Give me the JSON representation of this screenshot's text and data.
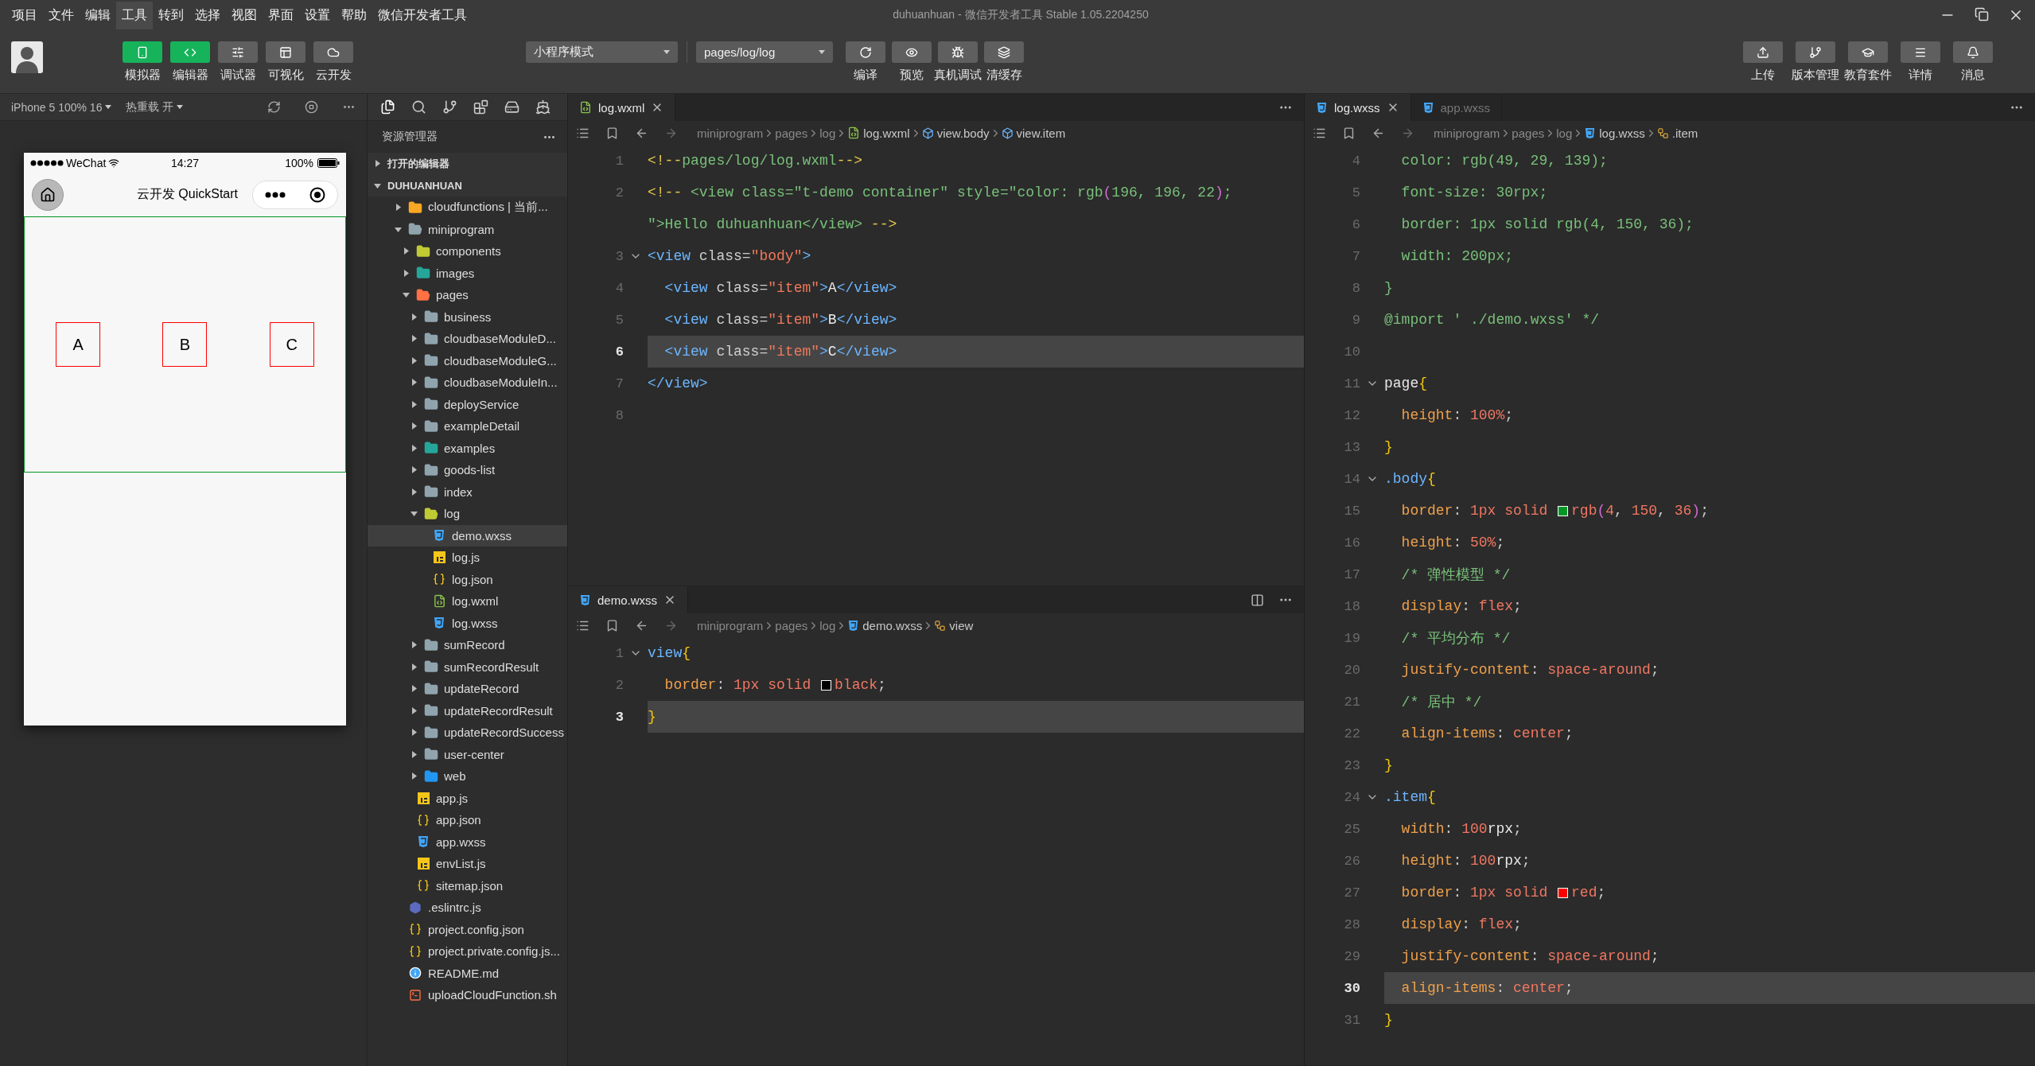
{
  "menu_bar": {
    "items": [
      {
        "label": "项目",
        "highlighted": false
      },
      {
        "label": "文件",
        "highlighted": false
      },
      {
        "label": "编辑",
        "highlighted": false
      },
      {
        "label": "工具",
        "highlighted": true
      },
      {
        "label": "转到",
        "highlighted": false
      },
      {
        "label": "选择",
        "highlighted": false
      },
      {
        "label": "视图",
        "highlighted": false
      },
      {
        "label": "界面",
        "highlighted": false
      },
      {
        "label": "设置",
        "highlighted": false
      },
      {
        "label": "帮助",
        "highlighted": false
      },
      {
        "label": "微信开发者工具",
        "highlighted": false
      }
    ],
    "title": "duhuanhuan - 微信开发者工具 Stable 1.05.2204250"
  },
  "toolbar": {
    "view_buttons": [
      {
        "label": "模拟器",
        "on": true
      },
      {
        "label": "编辑器",
        "on": true
      },
      {
        "label": "调试器",
        "on": false
      },
      {
        "label": "可视化",
        "on": false
      },
      {
        "label": "云开发",
        "on": false
      }
    ],
    "mode_select": "小程序模式",
    "page_select": "pages/log/log",
    "actions": [
      "编译",
      "预览",
      "真机调试",
      "清缓存"
    ],
    "right_buttons": [
      "上传",
      "版本管理",
      "教育套件",
      "详情",
      "消息"
    ]
  },
  "simulator": {
    "device": "iPhone 5 100% 16",
    "hot_reload": "热重载 开",
    "status_bar": {
      "carrier": "WeChat",
      "time": "14:27",
      "battery": "100%"
    },
    "nav_title": "云开发 QuickStart",
    "items": [
      "A",
      "B",
      "C"
    ]
  },
  "explorer": {
    "title": "资源管理器",
    "sections": [
      {
        "label": "打开的编辑器",
        "expanded": false
      },
      {
        "label": "DUHUANHUAN",
        "expanded": true,
        "children": [
          {
            "label": "cloudfunctions | 当前...",
            "kind": "folder",
            "color": "#f9a825",
            "expanded": false,
            "selected": false
          },
          {
            "label": "miniprogram",
            "kind": "folder",
            "color": "#90a4ae",
            "expanded": true,
            "selected": false,
            "children": [
              {
                "label": "components",
                "kind": "folder",
                "color": "#c0ca33",
                "expanded": false,
                "selected": false
              },
              {
                "label": "images",
                "kind": "folder",
                "color": "#26a69a",
                "expanded": false,
                "selected": false
              },
              {
                "label": "pages",
                "kind": "folder",
                "color": "#ff7043",
                "expanded": true,
                "selected": false,
                "children": [
                  {
                    "label": "business",
                    "kind": "folder",
                    "color": "#90a4ae",
                    "expanded": false,
                    "selected": false
                  },
                  {
                    "label": "cloudbaseModuleD...",
                    "kind": "folder",
                    "color": "#90a4ae",
                    "expanded": false,
                    "selected": false
                  },
                  {
                    "label": "cloudbaseModuleG...",
                    "kind": "folder",
                    "color": "#90a4ae",
                    "expanded": false,
                    "selected": false
                  },
                  {
                    "label": "cloudbaseModuleIn...",
                    "kind": "folder",
                    "color": "#90a4ae",
                    "expanded": false,
                    "selected": false
                  },
                  {
                    "label": "deployService",
                    "kind": "folder",
                    "color": "#90a4ae",
                    "expanded": false,
                    "selected": false
                  },
                  {
                    "label": "exampleDetail",
                    "kind": "folder",
                    "color": "#90a4ae",
                    "expanded": false,
                    "selected": false
                  },
                  {
                    "label": "examples",
                    "kind": "folder",
                    "color": "#26a69a",
                    "expanded": false,
                    "selected": false
                  },
                  {
                    "label": "goods-list",
                    "kind": "folder",
                    "color": "#90a4ae",
                    "expanded": false,
                    "selected": false
                  },
                  {
                    "label": "index",
                    "kind": "folder",
                    "color": "#90a4ae",
                    "expanded": false,
                    "selected": false
                  },
                  {
                    "label": "log",
                    "kind": "folder",
                    "color": "#c0ca33",
                    "expanded": true,
                    "selected": false,
                    "children": [
                      {
                        "label": "demo.wxss",
                        "kind": "wxss",
                        "selected": true
                      },
                      {
                        "label": "log.js",
                        "kind": "js",
                        "selected": false
                      },
                      {
                        "label": "log.json",
                        "kind": "json",
                        "selected": false
                      },
                      {
                        "label": "log.wxml",
                        "kind": "wxml",
                        "selected": false
                      },
                      {
                        "label": "log.wxss",
                        "kind": "wxss",
                        "selected": false
                      }
                    ]
                  },
                  {
                    "label": "sumRecord",
                    "kind": "folder",
                    "color": "#90a4ae",
                    "expanded": false,
                    "selected": false
                  },
                  {
                    "label": "sumRecordResult",
                    "kind": "folder",
                    "color": "#90a4ae",
                    "expanded": false,
                    "selected": false
                  },
                  {
                    "label": "updateRecord",
                    "kind": "folder",
                    "color": "#90a4ae",
                    "expanded": false,
                    "selected": false
                  },
                  {
                    "label": "updateRecordResult",
                    "kind": "folder",
                    "color": "#90a4ae",
                    "expanded": false,
                    "selected": false
                  },
                  {
                    "label": "updateRecordSuccess",
                    "kind": "folder",
                    "color": "#90a4ae",
                    "expanded": false,
                    "selected": false
                  },
                  {
                    "label": "user-center",
                    "kind": "folder",
                    "color": "#90a4ae",
                    "expanded": false,
                    "selected": false
                  },
                  {
                    "label": "web",
                    "kind": "folder",
                    "color": "#2196f3",
                    "expanded": false,
                    "selected": false
                  }
                ]
              },
              {
                "label": "app.js",
                "kind": "js",
                "selected": false
              },
              {
                "label": "app.json",
                "kind": "json",
                "selected": false
              },
              {
                "label": "app.wxss",
                "kind": "wxss",
                "selected": false
              },
              {
                "label": "envList.js",
                "kind": "js",
                "selected": false
              },
              {
                "label": "sitemap.json",
                "kind": "json",
                "selected": false
              }
            ]
          },
          {
            "label": ".eslintrc.js",
            "kind": "eslint",
            "selected": false
          },
          {
            "label": "project.config.json",
            "kind": "json",
            "selected": false
          },
          {
            "label": "project.private.config.js...",
            "kind": "json",
            "selected": false
          },
          {
            "label": "README.md",
            "kind": "readme",
            "selected": false
          },
          {
            "label": "uploadCloudFunction.sh",
            "kind": "shell",
            "selected": false
          }
        ]
      }
    ]
  },
  "editor_top": {
    "tabs": [
      {
        "label": "log.wxml",
        "kind": "wxml",
        "selected": true,
        "close": true
      }
    ],
    "breadcrumb": [
      {
        "label": "miniprogram",
        "kind": "folder"
      },
      {
        "label": "pages",
        "kind": "folder"
      },
      {
        "label": "log",
        "kind": "folder"
      },
      {
        "label": "log.wxml",
        "kind": "wxml"
      },
      {
        "label": "view.body",
        "kind": "element"
      },
      {
        "label": "view.item",
        "kind": "element"
      }
    ],
    "lines": [
      {
        "number": "1",
        "foldable": false,
        "current": false,
        "indented": false,
        "tokens": [
          {
            "kind": "cdelim",
            "text": "<!--"
          },
          {
            "kind": "comment",
            "text": "pages/log/log.wxml"
          },
          {
            "kind": "cdelim",
            "text": "-->"
          }
        ]
      },
      {
        "number": "2",
        "foldable": false,
        "current": false,
        "indented": false,
        "tokens": [
          {
            "kind": "cdelim",
            "text": "<!--"
          },
          {
            "kind": "comment",
            "text": " <view class=\"t-demo container\" style=\"color: rgb"
          },
          {
            "kind": "paren",
            "text": "("
          },
          {
            "kind": "comment",
            "text": "196, 196, 22"
          },
          {
            "kind": "paren",
            "text": ")"
          },
          {
            "kind": "comment",
            "text": ";"
          }
        ]
      },
      {
        "foldable": false,
        "current": false,
        "indented": false,
        "tokens": [
          {
            "kind": "comment",
            "text": "\">Hello duhuanhuan</view> "
          },
          {
            "kind": "cdelim",
            "text": "-->"
          }
        ]
      },
      {
        "number": "3",
        "foldable": true,
        "current": false,
        "indented": false,
        "tokens": [
          {
            "kind": "tag",
            "text": "<view"
          },
          {
            "kind": "attr",
            "text": " class"
          },
          {
            "kind": "punct",
            "text": "="
          },
          {
            "kind": "string",
            "text": "\"body\""
          },
          {
            "kind": "tag",
            "text": ">"
          }
        ]
      },
      {
        "number": "4",
        "foldable": false,
        "current": false,
        "indented": true,
        "tokens": [
          {
            "kind": "tag",
            "text": "<view"
          },
          {
            "kind": "attr",
            "text": " class"
          },
          {
            "kind": "punct",
            "text": "="
          },
          {
            "kind": "string",
            "text": "\"item\""
          },
          {
            "kind": "tag",
            "text": ">"
          },
          {
            "kind": "text",
            "text": "A"
          },
          {
            "kind": "tag",
            "text": "</view>"
          }
        ]
      },
      {
        "number": "5",
        "foldable": false,
        "current": false,
        "indented": true,
        "tokens": [
          {
            "kind": "tag",
            "text": "<view"
          },
          {
            "kind": "attr",
            "text": " class"
          },
          {
            "kind": "punct",
            "text": "="
          },
          {
            "kind": "string",
            "text": "\"item\""
          },
          {
            "kind": "tag",
            "text": ">"
          },
          {
            "kind": "text",
            "text": "B"
          },
          {
            "kind": "tag",
            "text": "</view>"
          }
        ]
      },
      {
        "number": "6",
        "foldable": false,
        "current": true,
        "indented": true,
        "tokens": [
          {
            "kind": "tag",
            "text": "<view"
          },
          {
            "kind": "attr",
            "text": " class"
          },
          {
            "kind": "punct",
            "text": "="
          },
          {
            "kind": "string",
            "text": "\"item\""
          },
          {
            "kind": "tag",
            "text": ">"
          },
          {
            "kind": "text",
            "text": "C"
          },
          {
            "kind": "tag",
            "text": "</view>"
          }
        ]
      },
      {
        "number": "7",
        "foldable": false,
        "current": false,
        "indented": false,
        "tokens": [
          {
            "kind": "tag",
            "text": "</view>"
          }
        ]
      },
      {
        "number": "8",
        "foldable": false,
        "current": false
      }
    ]
  },
  "editor_bottom": {
    "tabs": [
      {
        "label": "demo.wxss",
        "kind": "wxss",
        "selected": true,
        "close": true
      }
    ],
    "breadcrumb": [
      {
        "label": "miniprogram",
        "kind": "folder"
      },
      {
        "label": "pages",
        "kind": "folder"
      },
      {
        "label": "log",
        "kind": "folder"
      },
      {
        "label": "demo.wxss",
        "kind": "wxss"
      },
      {
        "label": "view",
        "kind": "rule"
      }
    ],
    "lines": [
      {
        "number": "1",
        "foldable": true,
        "current": false,
        "indented": false,
        "tokens": [
          {
            "kind": "selector",
            "text": "view"
          },
          {
            "kind": "brace",
            "text": "{"
          }
        ]
      },
      {
        "number": "2",
        "foldable": false,
        "current": false,
        "indented": true,
        "tokens": [
          {
            "kind": "prop",
            "text": "border"
          },
          {
            "kind": "punct",
            "text": ": "
          },
          {
            "kind": "value",
            "text": "1px solid "
          },
          {
            "kind": "swatch",
            "color": "#000000"
          },
          {
            "kind": "value",
            "text": "black"
          },
          {
            "kind": "punct",
            "text": ";"
          }
        ]
      },
      {
        "number": "3",
        "foldable": false,
        "current": true,
        "indented": false,
        "tokens": [
          {
            "kind": "brace",
            "text": "}"
          }
        ]
      }
    ]
  },
  "editor_right": {
    "tabs": [
      {
        "label": "log.wxss",
        "kind": "wxss",
        "selected": true,
        "close": true
      },
      {
        "label": "app.wxss",
        "kind": "wxss",
        "selected": false,
        "close": false
      }
    ],
    "breadcrumb": [
      {
        "label": "miniprogram",
        "kind": "folder"
      },
      {
        "label": "pages",
        "kind": "folder"
      },
      {
        "label": "log",
        "kind": "folder"
      },
      {
        "label": "log.wxss",
        "kind": "wxss"
      },
      {
        "label": ".item",
        "kind": "rule"
      }
    ],
    "lines": [
      {
        "number": "4",
        "foldable": false,
        "current": false,
        "indented": true,
        "tokens": [
          {
            "kind": "comment",
            "text": "color: rgb(49, 29, 139);"
          }
        ]
      },
      {
        "number": "5",
        "foldable": false,
        "current": false,
        "indented": true,
        "tokens": [
          {
            "kind": "comment",
            "text": "font-size: 30rpx;"
          }
        ]
      },
      {
        "number": "6",
        "foldable": false,
        "current": false,
        "indented": true,
        "tokens": [
          {
            "kind": "comment",
            "text": "border: 1px solid rgb(4, 150, 36);"
          }
        ]
      },
      {
        "number": "7",
        "foldable": false,
        "current": false,
        "indented": true,
        "tokens": [
          {
            "kind": "comment",
            "text": "width: 200px;"
          }
        ]
      },
      {
        "number": "8",
        "foldable": false,
        "current": false,
        "indented": false,
        "tokens": [
          {
            "kind": "comment",
            "text": "}"
          }
        ]
      },
      {
        "number": "9",
        "foldable": false,
        "current": false,
        "indented": false,
        "tokens": [
          {
            "kind": "comment",
            "text": "@import ' ./demo.wxss' */"
          }
        ]
      },
      {
        "number": "10",
        "foldable": false,
        "current": false
      },
      {
        "number": "11",
        "foldable": true,
        "current": false,
        "indented": false,
        "tokens": [
          {
            "kind": "element",
            "text": "page"
          },
          {
            "kind": "brace",
            "text": "{"
          }
        ]
      },
      {
        "number": "12",
        "foldable": false,
        "current": false,
        "indented": true,
        "tokens": [
          {
            "kind": "prop",
            "text": "height"
          },
          {
            "kind": "punct",
            "text": ": "
          },
          {
            "kind": "value",
            "text": "100%"
          },
          {
            "kind": "punct",
            "text": ";"
          }
        ]
      },
      {
        "number": "13",
        "foldable": false,
        "current": false,
        "indented": false,
        "tokens": [
          {
            "kind": "brace",
            "text": "}"
          }
        ]
      },
      {
        "number": "14",
        "foldable": true,
        "current": false,
        "indented": false,
        "tokens": [
          {
            "kind": "selector",
            "text": ".body"
          },
          {
            "kind": "brace",
            "text": "{"
          }
        ]
      },
      {
        "number": "15",
        "foldable": false,
        "current": false,
        "indented": true,
        "tokens": [
          {
            "kind": "prop",
            "text": "border"
          },
          {
            "kind": "punct",
            "text": ": "
          },
          {
            "kind": "value",
            "text": "1px solid "
          },
          {
            "kind": "swatch",
            "color": "#049624"
          },
          {
            "kind": "value",
            "text": "rgb"
          },
          {
            "kind": "paren",
            "text": "("
          },
          {
            "kind": "value",
            "text": "4"
          },
          {
            "kind": "punct",
            "text": ", "
          },
          {
            "kind": "value",
            "text": "150"
          },
          {
            "kind": "punct",
            "text": ", "
          },
          {
            "kind": "value",
            "text": "36"
          },
          {
            "kind": "paren",
            "text": ")"
          },
          {
            "kind": "punct",
            "text": ";"
          }
        ]
      },
      {
        "number": "16",
        "foldable": false,
        "current": false,
        "indented": true,
        "tokens": [
          {
            "kind": "prop",
            "text": "height"
          },
          {
            "kind": "punct",
            "text": ": "
          },
          {
            "kind": "value",
            "text": "50%"
          },
          {
            "kind": "punct",
            "text": ";"
          }
        ]
      },
      {
        "number": "17",
        "foldable": false,
        "current": false,
        "indented": true,
        "tokens": [
          {
            "kind": "comment",
            "text": "/* 弹性模型 */"
          }
        ]
      },
      {
        "number": "18",
        "foldable": false,
        "current": false,
        "indented": true,
        "tokens": [
          {
            "kind": "prop",
            "text": "display"
          },
          {
            "kind": "punct",
            "text": ": "
          },
          {
            "kind": "value",
            "text": "flex"
          },
          {
            "kind": "punct",
            "text": ";"
          }
        ]
      },
      {
        "number": "19",
        "foldable": false,
        "current": false,
        "indented": true,
        "tokens": [
          {
            "kind": "comment",
            "text": "/* 平均分布 */"
          }
        ]
      },
      {
        "number": "20",
        "foldable": false,
        "current": false,
        "indented": true,
        "tokens": [
          {
            "kind": "prop",
            "text": "justify-content"
          },
          {
            "kind": "punct",
            "text": ": "
          },
          {
            "kind": "value",
            "text": "space-around"
          },
          {
            "kind": "punct",
            "text": ";"
          }
        ]
      },
      {
        "number": "21",
        "foldable": false,
        "current": false,
        "indented": true,
        "tokens": [
          {
            "kind": "comment",
            "text": "/* 居中 */"
          }
        ]
      },
      {
        "number": "22",
        "foldable": false,
        "current": false,
        "indented": true,
        "tokens": [
          {
            "kind": "prop",
            "text": "align-items"
          },
          {
            "kind": "punct",
            "text": ": "
          },
          {
            "kind": "value",
            "text": "center"
          },
          {
            "kind": "punct",
            "text": ";"
          }
        ]
      },
      {
        "number": "23",
        "foldable": false,
        "current": false,
        "indented": false,
        "tokens": [
          {
            "kind": "brace",
            "text": "}"
          }
        ]
      },
      {
        "number": "24",
        "foldable": true,
        "current": false,
        "indented": false,
        "tokens": [
          {
            "kind": "selector",
            "text": ".item"
          },
          {
            "kind": "brace",
            "text": "{"
          }
        ]
      },
      {
        "number": "25",
        "foldable": false,
        "current": false,
        "indented": true,
        "tokens": [
          {
            "kind": "prop",
            "text": "width"
          },
          {
            "kind": "punct",
            "text": ": "
          },
          {
            "kind": "value",
            "text": "100"
          },
          {
            "kind": "text",
            "text": "rpx"
          },
          {
            "kind": "punct",
            "text": ";"
          }
        ]
      },
      {
        "number": "26",
        "foldable": false,
        "current": false,
        "indented": true,
        "tokens": [
          {
            "kind": "prop",
            "text": "height"
          },
          {
            "kind": "punct",
            "text": ": "
          },
          {
            "kind": "value",
            "text": "100"
          },
          {
            "kind": "text",
            "text": "rpx"
          },
          {
            "kind": "punct",
            "text": ";"
          }
        ]
      },
      {
        "number": "27",
        "foldable": false,
        "current": false,
        "indented": true,
        "tokens": [
          {
            "kind": "prop",
            "text": "border"
          },
          {
            "kind": "punct",
            "text": ": "
          },
          {
            "kind": "value",
            "text": "1px solid "
          },
          {
            "kind": "swatch",
            "color": "#ff0000"
          },
          {
            "kind": "value",
            "text": "red"
          },
          {
            "kind": "punct",
            "text": ";"
          }
        ]
      },
      {
        "number": "28",
        "foldable": false,
        "current": false,
        "indented": true,
        "tokens": [
          {
            "kind": "prop",
            "text": "display"
          },
          {
            "kind": "punct",
            "text": ": "
          },
          {
            "kind": "value",
            "text": "flex"
          },
          {
            "kind": "punct",
            "text": ";"
          }
        ]
      },
      {
        "number": "29",
        "foldable": false,
        "current": false,
        "indented": true,
        "tokens": [
          {
            "kind": "prop",
            "text": "justify-content"
          },
          {
            "kind": "punct",
            "text": ": "
          },
          {
            "kind": "value",
            "text": "space-around"
          },
          {
            "kind": "punct",
            "text": ";"
          }
        ]
      },
      {
        "number": "30",
        "foldable": false,
        "current": true,
        "indented": true,
        "tokens": [
          {
            "kind": "prop",
            "text": "align-items"
          },
          {
            "kind": "punct",
            "text": ": "
          },
          {
            "kind": "value",
            "text": "center"
          },
          {
            "kind": "punct",
            "text": ";"
          }
        ]
      },
      {
        "number": "31",
        "foldable": false,
        "current": false,
        "indented": false,
        "tokens": [
          {
            "kind": "brace",
            "text": "}"
          }
        ]
      }
    ]
  }
}
